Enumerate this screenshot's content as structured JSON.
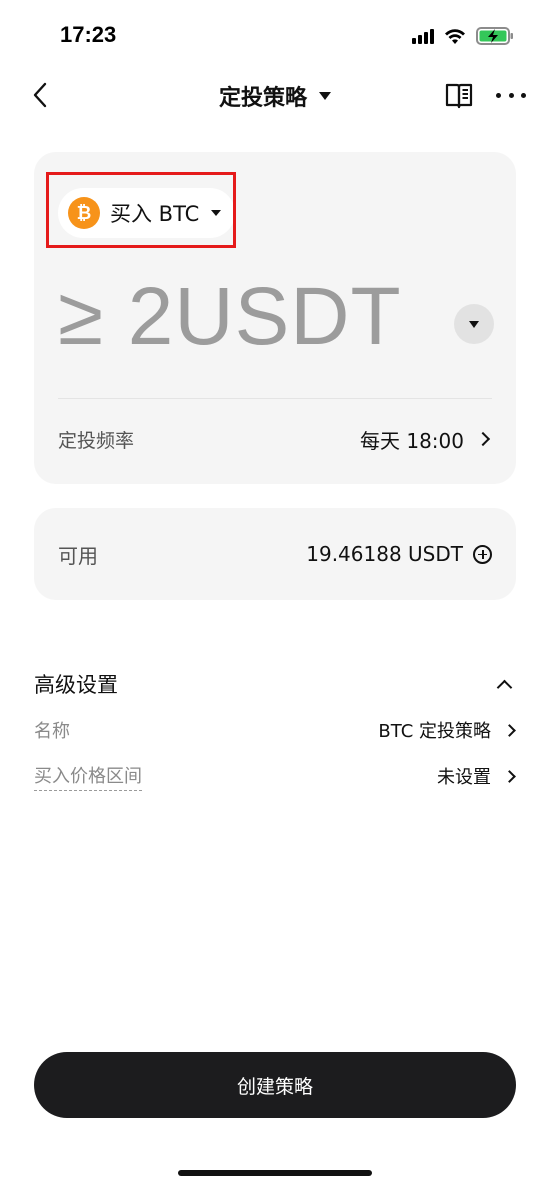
{
  "status_bar": {
    "time": "17:23"
  },
  "nav": {
    "title": "定投策略"
  },
  "buy": {
    "icon_symbol": "₿",
    "label": "买入 BTC"
  },
  "amount": {
    "value": "≥ 2USDT"
  },
  "frequency": {
    "label": "定投频率",
    "value": "每天 18:00"
  },
  "available": {
    "label": "可用",
    "value": "19.46188 USDT"
  },
  "advanced": {
    "title": "高级设置",
    "rows": [
      {
        "label": "名称",
        "value": "BTC 定投策略"
      },
      {
        "label": "买入价格区间",
        "value": "未设置"
      }
    ]
  },
  "create_button": {
    "label": "创建策略"
  },
  "colors": {
    "btc": "#f7931a",
    "highlight": "#e51a1a",
    "button": "#1c1c1e",
    "card": "#f5f5f5"
  }
}
